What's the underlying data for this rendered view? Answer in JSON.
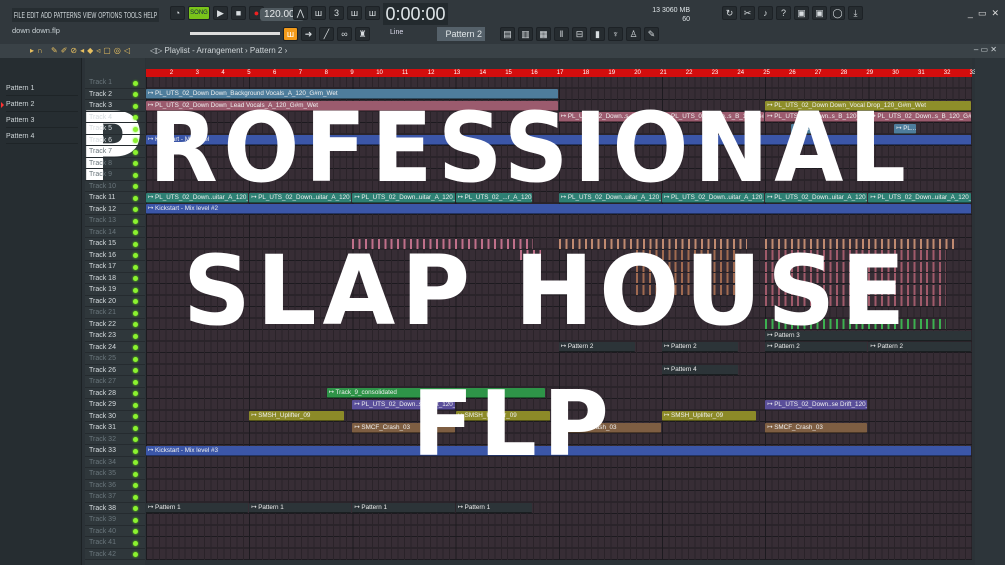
{
  "menu": [
    "FILE",
    "EDIT",
    "ADD",
    "PATTERNS",
    "VIEW",
    "OPTIONS",
    "TOOLS",
    "HELP"
  ],
  "file_name": "down down.flp",
  "transport": {
    "mode": "SONG",
    "tempo": "120.000",
    "time": "0:00:00",
    "snap": "Line",
    "pattern": "Pattern 2"
  },
  "memory": {
    "cpu": "13",
    "ram": "3060 MB",
    "poly": "60"
  },
  "playlist": {
    "title": "Playlist - Arrangement",
    "breadcrumb": "Pattern 2"
  },
  "patterns": [
    "Pattern 1",
    "Pattern 2",
    "Pattern 3",
    "Pattern 4"
  ],
  "selected_pattern": 1,
  "bars": [
    "2",
    "3",
    "4",
    "5",
    "6",
    "7",
    "8",
    "9",
    "10",
    "11",
    "12",
    "13",
    "14",
    "15",
    "16",
    "17",
    "18",
    "19",
    "20",
    "21",
    "22",
    "23",
    "24",
    "25",
    "26",
    "27",
    "28",
    "29",
    "30",
    "31",
    "32",
    "33"
  ],
  "track_count": 42,
  "track_prefix": "Track",
  "clips": [
    {
      "t": 2,
      "s": 1,
      "l": 16,
      "c": "#4e7d9c",
      "label": "PL_UTS_02_Down Down_Background Vocals_A_120_G#m_Wet"
    },
    {
      "t": 3,
      "s": 1,
      "l": 16,
      "c": "#9b5b6e",
      "label": "PL_UTS_02_Down Down_Lead Vocals_A_120_G#m_Wet"
    },
    {
      "t": 3,
      "s": 25,
      "l": 8,
      "c": "#8e8e2a",
      "label": "PL_UTS_02_Down Down_Vocal Drop_120_G#m_Wet"
    },
    {
      "t": 4,
      "s": 17,
      "l": 4,
      "c": "#9b5b6e",
      "label": "PL_UTS_02_Down..s_B_120_G#m_Wet"
    },
    {
      "t": 4,
      "s": 21,
      "l": 4,
      "c": "#9b5b6e",
      "label": "PL_UTS_02_Down..s_B_120_G#m_Wet"
    },
    {
      "t": 4,
      "s": 25,
      "l": 4,
      "c": "#9b5b6e",
      "label": "PL_UTS_02_Down..s_B_120_G#m_Wet"
    },
    {
      "t": 4,
      "s": 29,
      "l": 4,
      "c": "#9b5b6e",
      "label": "PL_UTS_02_Down..s_B_120_G#m_Wet"
    },
    {
      "t": 5,
      "s": 26,
      "l": 0.9,
      "c": "#4e7d9c",
      "label": "PL...et"
    },
    {
      "t": 5,
      "s": 30,
      "l": 0.9,
      "c": "#4e7d9c",
      "label": "PL...et"
    },
    {
      "t": 6,
      "s": 1,
      "l": 32,
      "c": "#3b56a8",
      "label": "Kickstart - Mix level"
    },
    {
      "t": 11,
      "s": 1,
      "l": 4,
      "c": "#2e8074",
      "label": "PL_UTS_02_Down..uitar_A_120_G#m"
    },
    {
      "t": 11,
      "s": 5,
      "l": 4,
      "c": "#2e8074",
      "label": "PL_UTS_02_Down..uitar_A_120_G#m"
    },
    {
      "t": 11,
      "s": 9,
      "l": 4,
      "c": "#2e8074",
      "label": "PL_UTS_02_Down..uitar_A_120_G#m"
    },
    {
      "t": 11,
      "s": 13,
      "l": 3,
      "c": "#2e8074",
      "label": "PL_UTS_02_...r_A_120_G#m"
    },
    {
      "t": 11,
      "s": 17,
      "l": 4,
      "c": "#2e8074",
      "label": "PL_UTS_02_Down..uitar_A_120_G#m"
    },
    {
      "t": 11,
      "s": 21,
      "l": 4,
      "c": "#2e8074",
      "label": "PL_UTS_02_Down..uitar_A_120_G#m"
    },
    {
      "t": 11,
      "s": 25,
      "l": 4,
      "c": "#2e8074",
      "label": "PL_UTS_02_Down..uitar_A_120_G#m"
    },
    {
      "t": 11,
      "s": 29,
      "l": 4,
      "c": "#2e8074",
      "label": "PL_UTS_02_Down..uitar_A_120_G#m"
    },
    {
      "t": 12,
      "s": 1,
      "l": 32,
      "c": "#3b56a8",
      "label": "Kickstart - Mix level #2"
    },
    {
      "t": 23,
      "s": 25,
      "l": 8,
      "c": "#2c3438",
      "label": "Pattern 3"
    },
    {
      "t": 24,
      "s": 17,
      "l": 3,
      "c": "#2c3438",
      "label": "Pattern 2"
    },
    {
      "t": 24,
      "s": 21,
      "l": 3,
      "c": "#2c3438",
      "label": "Pattern 2"
    },
    {
      "t": 24,
      "s": 25,
      "l": 4,
      "c": "#2c3438",
      "label": "Pattern 2"
    },
    {
      "t": 24,
      "s": 29,
      "l": 4,
      "c": "#2c3438",
      "label": "Pattern 2"
    },
    {
      "t": 26,
      "s": 21,
      "l": 3,
      "c": "#2c3438",
      "label": "Pattern 4"
    },
    {
      "t": 28,
      "s": 8,
      "l": 8.5,
      "c": "#2e9448",
      "label": "Track_9_consolidated"
    },
    {
      "t": 29,
      "s": 9,
      "l": 4,
      "c": "#5a4f9a",
      "label": "PL_UTS_02_Down..se Drift_120_G#m"
    },
    {
      "t": 29,
      "s": 25,
      "l": 4,
      "c": "#5a4f9a",
      "label": "PL_UTS_02_Down..se Drift_120_G#m"
    },
    {
      "t": 30,
      "s": 5,
      "l": 3.7,
      "c": "#8c8a28",
      "label": "SMSH_Uplifter_09"
    },
    {
      "t": 30,
      "s": 13,
      "l": 3.7,
      "c": "#8c8a28",
      "label": "SMSH_Uplifter_09"
    },
    {
      "t": 30,
      "s": 21,
      "l": 3.7,
      "c": "#8c8a28",
      "label": "SMSH_Uplifter_09"
    },
    {
      "t": 31,
      "s": 9,
      "l": 4,
      "c": "#7e5e42",
      "label": "SMCF_Crash_03"
    },
    {
      "t": 31,
      "s": 17,
      "l": 4,
      "c": "#7e5e42",
      "label": "SMCF_Crash_03"
    },
    {
      "t": 31,
      "s": 25,
      "l": 4,
      "c": "#7e5e42",
      "label": "SMCF_Crash_03"
    },
    {
      "t": 33,
      "s": 1,
      "l": 32,
      "c": "#3b56a8",
      "label": "Kickstart - Mix level #3"
    },
    {
      "t": 38,
      "s": 1,
      "l": 4,
      "c": "#2c3438",
      "label": "Pattern 1"
    },
    {
      "t": 38,
      "s": 5,
      "l": 4,
      "c": "#2c3438",
      "label": "Pattern 1"
    },
    {
      "t": 38,
      "s": 9,
      "l": 4,
      "c": "#2c3438",
      "label": "Pattern 1"
    },
    {
      "t": 38,
      "s": 13,
      "l": 3,
      "c": "#2c3438",
      "label": "Pattern 1"
    }
  ],
  "note_clips": [
    {
      "t": 15,
      "s": 9,
      "l": 7,
      "c": "#c0708a"
    },
    {
      "t": 16,
      "s": 15.5,
      "l": 0.8,
      "c": "#c0708a"
    },
    {
      "t": 15,
      "s": 17,
      "l": 7.3,
      "c": "#c08a70"
    },
    {
      "t": 15,
      "s": 25,
      "l": 7.3,
      "c": "#c08a70"
    },
    {
      "t": 16,
      "s": 20,
      "l": 4,
      "c": "#a06a50"
    },
    {
      "t": 17,
      "s": 20,
      "l": 4,
      "c": "#a06a50"
    },
    {
      "t": 18,
      "s": 20,
      "l": 4,
      "c": "#a06a50"
    },
    {
      "t": 19,
      "s": 20,
      "l": 4,
      "c": "#a06a50"
    },
    {
      "t": 16,
      "s": 25,
      "l": 7,
      "c": "#a05a6a"
    },
    {
      "t": 17,
      "s": 25,
      "l": 7,
      "c": "#a05a6a"
    },
    {
      "t": 18,
      "s": 25,
      "l": 7,
      "c": "#a05a6a"
    },
    {
      "t": 19,
      "s": 25,
      "l": 7,
      "c": "#a05a6a"
    },
    {
      "t": 20,
      "s": 25,
      "l": 7,
      "c": "#a05a6a"
    },
    {
      "t": 22,
      "s": 25,
      "l": 7,
      "c": "#3cb050"
    }
  ],
  "overlay": {
    "line1": "PROFESSIONAL",
    "line2": "SLAP HOUSE",
    "line3": "FLP"
  }
}
